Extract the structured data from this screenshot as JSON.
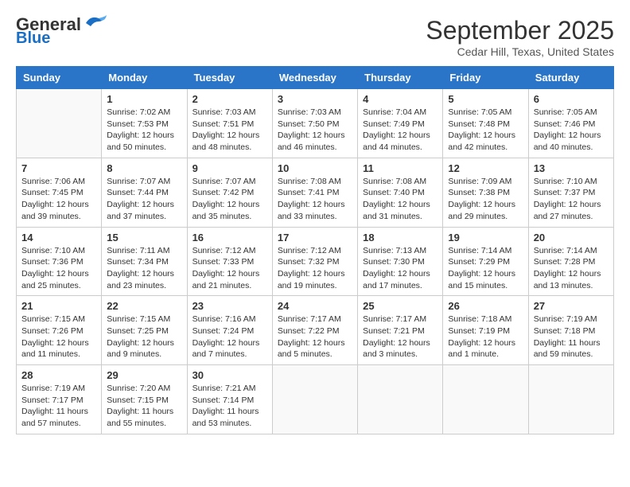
{
  "header": {
    "logo_general": "General",
    "logo_blue": "Blue",
    "month": "September 2025",
    "location": "Cedar Hill, Texas, United States"
  },
  "days_of_week": [
    "Sunday",
    "Monday",
    "Tuesday",
    "Wednesday",
    "Thursday",
    "Friday",
    "Saturday"
  ],
  "weeks": [
    [
      {
        "day": "",
        "info": ""
      },
      {
        "day": "1",
        "info": "Sunrise: 7:02 AM\nSunset: 7:53 PM\nDaylight: 12 hours\nand 50 minutes."
      },
      {
        "day": "2",
        "info": "Sunrise: 7:03 AM\nSunset: 7:51 PM\nDaylight: 12 hours\nand 48 minutes."
      },
      {
        "day": "3",
        "info": "Sunrise: 7:03 AM\nSunset: 7:50 PM\nDaylight: 12 hours\nand 46 minutes."
      },
      {
        "day": "4",
        "info": "Sunrise: 7:04 AM\nSunset: 7:49 PM\nDaylight: 12 hours\nand 44 minutes."
      },
      {
        "day": "5",
        "info": "Sunrise: 7:05 AM\nSunset: 7:48 PM\nDaylight: 12 hours\nand 42 minutes."
      },
      {
        "day": "6",
        "info": "Sunrise: 7:05 AM\nSunset: 7:46 PM\nDaylight: 12 hours\nand 40 minutes."
      }
    ],
    [
      {
        "day": "7",
        "info": "Sunrise: 7:06 AM\nSunset: 7:45 PM\nDaylight: 12 hours\nand 39 minutes."
      },
      {
        "day": "8",
        "info": "Sunrise: 7:07 AM\nSunset: 7:44 PM\nDaylight: 12 hours\nand 37 minutes."
      },
      {
        "day": "9",
        "info": "Sunrise: 7:07 AM\nSunset: 7:42 PM\nDaylight: 12 hours\nand 35 minutes."
      },
      {
        "day": "10",
        "info": "Sunrise: 7:08 AM\nSunset: 7:41 PM\nDaylight: 12 hours\nand 33 minutes."
      },
      {
        "day": "11",
        "info": "Sunrise: 7:08 AM\nSunset: 7:40 PM\nDaylight: 12 hours\nand 31 minutes."
      },
      {
        "day": "12",
        "info": "Sunrise: 7:09 AM\nSunset: 7:38 PM\nDaylight: 12 hours\nand 29 minutes."
      },
      {
        "day": "13",
        "info": "Sunrise: 7:10 AM\nSunset: 7:37 PM\nDaylight: 12 hours\nand 27 minutes."
      }
    ],
    [
      {
        "day": "14",
        "info": "Sunrise: 7:10 AM\nSunset: 7:36 PM\nDaylight: 12 hours\nand 25 minutes."
      },
      {
        "day": "15",
        "info": "Sunrise: 7:11 AM\nSunset: 7:34 PM\nDaylight: 12 hours\nand 23 minutes."
      },
      {
        "day": "16",
        "info": "Sunrise: 7:12 AM\nSunset: 7:33 PM\nDaylight: 12 hours\nand 21 minutes."
      },
      {
        "day": "17",
        "info": "Sunrise: 7:12 AM\nSunset: 7:32 PM\nDaylight: 12 hours\nand 19 minutes."
      },
      {
        "day": "18",
        "info": "Sunrise: 7:13 AM\nSunset: 7:30 PM\nDaylight: 12 hours\nand 17 minutes."
      },
      {
        "day": "19",
        "info": "Sunrise: 7:14 AM\nSunset: 7:29 PM\nDaylight: 12 hours\nand 15 minutes."
      },
      {
        "day": "20",
        "info": "Sunrise: 7:14 AM\nSunset: 7:28 PM\nDaylight: 12 hours\nand 13 minutes."
      }
    ],
    [
      {
        "day": "21",
        "info": "Sunrise: 7:15 AM\nSunset: 7:26 PM\nDaylight: 12 hours\nand 11 minutes."
      },
      {
        "day": "22",
        "info": "Sunrise: 7:15 AM\nSunset: 7:25 PM\nDaylight: 12 hours\nand 9 minutes."
      },
      {
        "day": "23",
        "info": "Sunrise: 7:16 AM\nSunset: 7:24 PM\nDaylight: 12 hours\nand 7 minutes."
      },
      {
        "day": "24",
        "info": "Sunrise: 7:17 AM\nSunset: 7:22 PM\nDaylight: 12 hours\nand 5 minutes."
      },
      {
        "day": "25",
        "info": "Sunrise: 7:17 AM\nSunset: 7:21 PM\nDaylight: 12 hours\nand 3 minutes."
      },
      {
        "day": "26",
        "info": "Sunrise: 7:18 AM\nSunset: 7:19 PM\nDaylight: 12 hours\nand 1 minute."
      },
      {
        "day": "27",
        "info": "Sunrise: 7:19 AM\nSunset: 7:18 PM\nDaylight: 11 hours\nand 59 minutes."
      }
    ],
    [
      {
        "day": "28",
        "info": "Sunrise: 7:19 AM\nSunset: 7:17 PM\nDaylight: 11 hours\nand 57 minutes."
      },
      {
        "day": "29",
        "info": "Sunrise: 7:20 AM\nSunset: 7:15 PM\nDaylight: 11 hours\nand 55 minutes."
      },
      {
        "day": "30",
        "info": "Sunrise: 7:21 AM\nSunset: 7:14 PM\nDaylight: 11 hours\nand 53 minutes."
      },
      {
        "day": "",
        "info": ""
      },
      {
        "day": "",
        "info": ""
      },
      {
        "day": "",
        "info": ""
      },
      {
        "day": "",
        "info": ""
      }
    ]
  ]
}
